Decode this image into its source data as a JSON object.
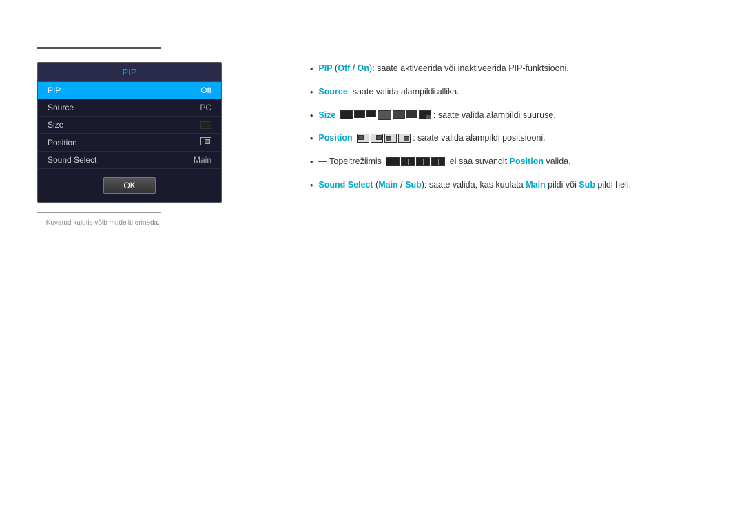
{
  "topLines": {},
  "pipPanel": {
    "title": "PIP",
    "items": [
      {
        "label": "PIP",
        "value": "Off",
        "active": true
      },
      {
        "label": "Source",
        "value": "PC",
        "active": false
      },
      {
        "label": "Size",
        "value": "",
        "active": false,
        "hasIcon": "size"
      },
      {
        "label": "Position",
        "value": "",
        "active": false,
        "hasIcon": "position"
      },
      {
        "label": "Sound Select",
        "value": "Main",
        "active": false
      }
    ],
    "okButton": "OK"
  },
  "note": "―  Kuvatud kujutis võib mudeliti erineda.",
  "bullets": [
    {
      "id": 1,
      "text_parts": [
        {
          "text": "PIP",
          "style": "cyan"
        },
        {
          "text": " ("
        },
        {
          "text": "Off",
          "style": "cyan"
        },
        {
          "text": " / "
        },
        {
          "text": "On",
          "style": "cyan"
        },
        {
          "text": "): saate aktiveerida või inaktiveerida PIP-funktsiooni."
        }
      ]
    },
    {
      "id": 2,
      "text_parts": [
        {
          "text": "Source",
          "style": "cyan"
        },
        {
          "text": ": saate valida alampildi allika."
        }
      ]
    },
    {
      "id": 3,
      "text_parts": [
        {
          "text": "Size",
          "style": "cyan"
        },
        {
          "text": ": saate valida alampildi suuruse.",
          "after_icons": "size"
        }
      ]
    },
    {
      "id": 4,
      "text_parts": [
        {
          "text": "Position",
          "style": "cyan"
        },
        {
          "text": ": saate valida alampildi positsiooni.",
          "after_icons": "position"
        }
      ]
    },
    {
      "id": 5,
      "prefix": "— Topeltrežiimis",
      "text_parts": [
        {
          "text": " ei saa suvandit "
        },
        {
          "text": "Position",
          "style": "cyan"
        },
        {
          "text": " valida.",
          "after_icons": "double"
        }
      ]
    },
    {
      "id": 6,
      "text_parts": [
        {
          "text": "Sound Select",
          "style": "cyan"
        },
        {
          "text": " ("
        },
        {
          "text": "Main",
          "style": "cyan"
        },
        {
          "text": " / "
        },
        {
          "text": "Sub",
          "style": "cyan"
        },
        {
          "text": "): saate valida, kas kuulata "
        },
        {
          "text": "Main",
          "style": "cyan"
        },
        {
          "text": " pildi või "
        },
        {
          "text": "Sub",
          "style": "cyan"
        },
        {
          "text": " pildi heli."
        }
      ]
    }
  ]
}
